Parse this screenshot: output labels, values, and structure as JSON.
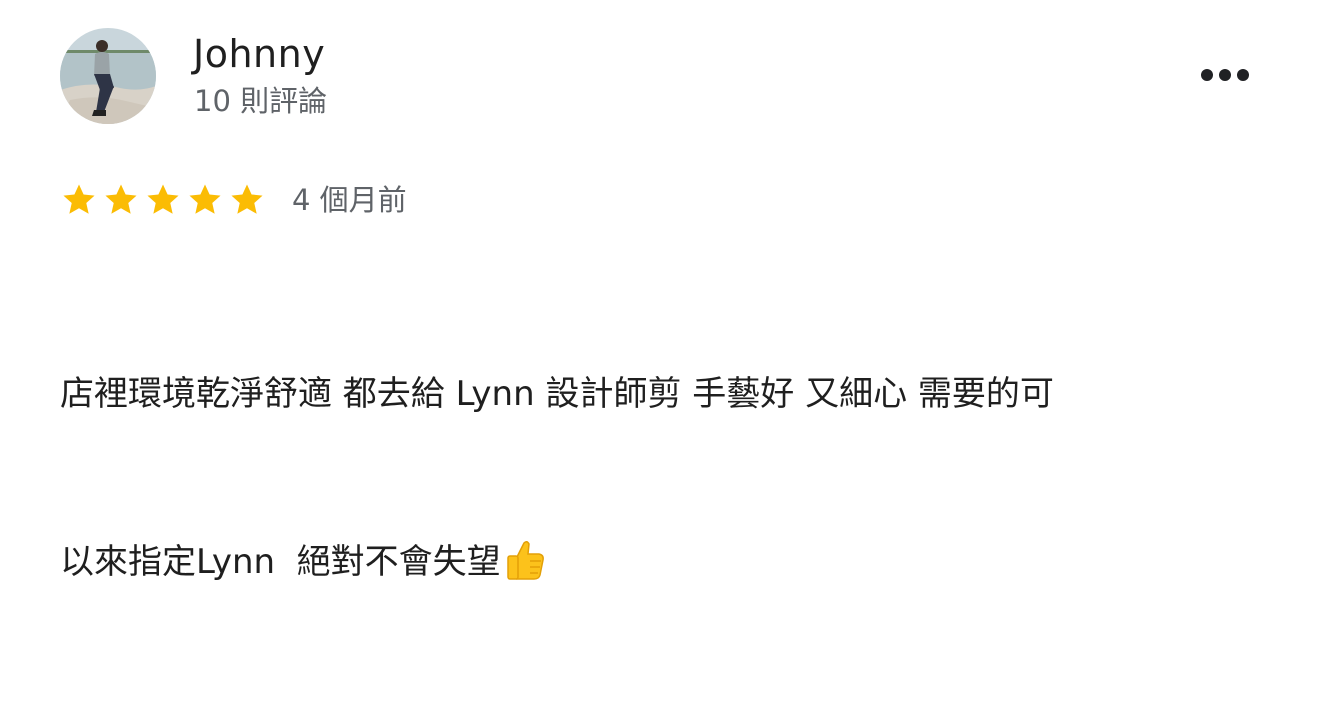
{
  "reviewer": {
    "name": "Johnny",
    "review_count": "10 則評論"
  },
  "rating": {
    "stars": 5,
    "max_stars": 5,
    "time": "4 個月前",
    "star_color": "#fbbc04"
  },
  "review": {
    "line1": "店裡環境乾淨舒適 都去給 Lynn 設計師剪 手藝好 又細心 需要的可",
    "line2": "以來指定Lynn  絕對不會失望"
  },
  "icons": {
    "more": "more-horiz-icon",
    "emoji": "thumbs-up-emoji"
  }
}
